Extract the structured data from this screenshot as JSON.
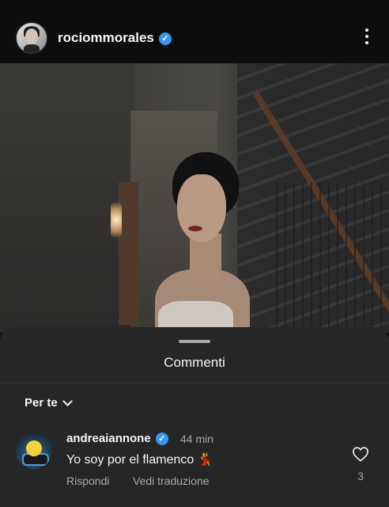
{
  "header": {
    "username": "rociommorales",
    "verified": true
  },
  "comments_sheet": {
    "title": "Commenti",
    "sort_label": "Per te",
    "comments": [
      {
        "username": "andreaiannone",
        "verified": true,
        "time": "44 min",
        "text": "Yo soy por el flamenco",
        "emoji": "💃",
        "reply_label": "Rispondi",
        "translate_label": "Vedi traduzione",
        "likes": "3"
      }
    ]
  },
  "colors": {
    "verified_badge": "#3797f0",
    "sheet_background": "#262626",
    "secondary_text": "#a8a8a8"
  }
}
